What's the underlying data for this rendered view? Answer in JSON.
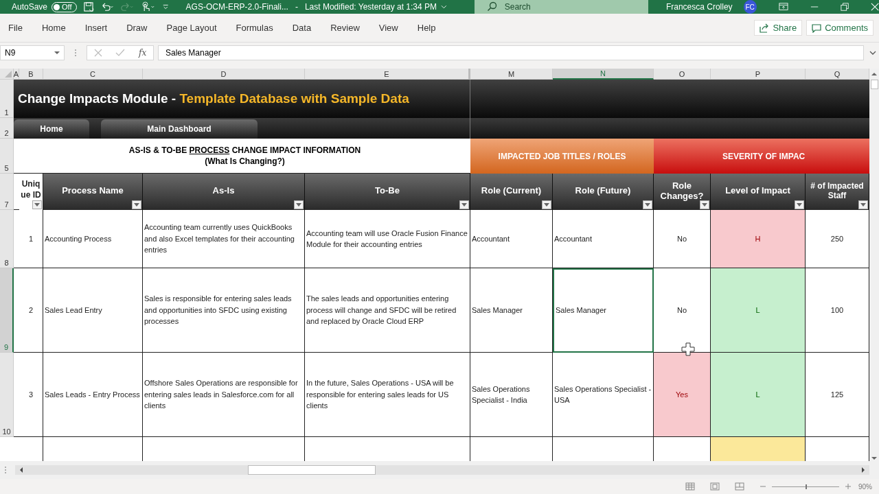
{
  "title_bar": {
    "autosave_label": "AutoSave",
    "autosave_toggle": {
      "label": "Off",
      "on": false
    },
    "document_title": "AGS-OCM-ERP-2.0-Finali...",
    "separator": "-",
    "modified": "Last Modified: Yesterday at 1:34 PM",
    "search_placeholder": "Search",
    "user_name": "Francesca Crolley",
    "user_initials": "FC"
  },
  "ribbon_tabs": [
    {
      "label": "File",
      "selected": false
    },
    {
      "label": "Home",
      "selected": false
    },
    {
      "label": "Insert",
      "selected": false
    },
    {
      "label": "Draw",
      "selected": false
    },
    {
      "label": "Page Layout",
      "selected": false
    },
    {
      "label": "Formulas",
      "selected": false
    },
    {
      "label": "Data",
      "selected": false
    },
    {
      "label": "Review",
      "selected": false
    },
    {
      "label": "View",
      "selected": false
    },
    {
      "label": "Help",
      "selected": false
    }
  ],
  "share": "Share",
  "comments": "Comments",
  "formula_bar": {
    "name_box": "N9",
    "function_label": "fx",
    "value": "Sales Manager"
  },
  "column_headers": [
    {
      "label": "A",
      "selected": false
    },
    {
      "label": "B",
      "selected": false
    },
    {
      "label": "C",
      "selected": false
    },
    {
      "label": "D",
      "selected": false
    },
    {
      "label": "E",
      "selected": false
    },
    {
      "label": "M",
      "selected": false
    },
    {
      "label": "N",
      "selected": true
    },
    {
      "label": "O",
      "selected": false
    },
    {
      "label": "P",
      "selected": false
    },
    {
      "label": "Q",
      "selected": false
    }
  ],
  "row_headers": [
    {
      "label": "1",
      "selected": false
    },
    {
      "label": "2",
      "selected": false
    },
    {
      "label": "5",
      "selected": false
    },
    {
      "label": "7",
      "selected": false
    },
    {
      "label": "8",
      "selected": false
    },
    {
      "label": "9",
      "selected": true
    },
    {
      "label": "10",
      "selected": false
    }
  ],
  "banner": {
    "title": "Change Impacts Module - ",
    "subtitle": "Template Database with Sample Data"
  },
  "nav_buttons": [
    "Home",
    "Main Dashboard"
  ],
  "process_section": {
    "before": "AS-IS & TO-BE ",
    "underlined": "PROCESS",
    "after": " CHANGE IMPACT INFORMATION",
    "subtitle": "(What Is Changing?)"
  },
  "group_headers": [
    "IMPACTED JOB TITLES / ROLES",
    "SEVERITY OF IMPAC"
  ],
  "columns": [
    "Unique ID",
    "Process Name",
    "As-Is",
    "To-Be",
    "Role (Current)",
    "Role (Future)",
    "Role Changes?",
    "Level of Impact",
    "# of Impacted Staff"
  ],
  "rows": [
    {
      "id": "1",
      "process": "Accounting Process",
      "as_is": "Accounting team currently uses QuickBooks and also Excel templates for their accounting entries",
      "to_be": "Accounting team will use Oracle Fusion Finance Module for their accounting entries",
      "role_current": "Accountant",
      "role_future": "Accountant",
      "role_future_selected": false,
      "role_changes": {
        "text": "No",
        "color": "#ffffff"
      },
      "level": {
        "text": "H",
        "color": "#f8c9cd"
      },
      "staff": "250"
    },
    {
      "id": "2",
      "process": "Sales Lead Entry",
      "as_is": "Sales is responsible for entering sales leads and opportunities into SFDC using existing processes",
      "to_be": "The sales leads and opportunities entering process will change and SFDC will be retired and replaced by Oracle Cloud ERP",
      "role_current": "Sales Manager",
      "role_future": "Sales Manager",
      "role_future_selected": true,
      "role_changes": {
        "text": "No",
        "color": "#ffffff"
      },
      "level": {
        "text": "L",
        "color": "#c6efce"
      },
      "staff": "100"
    },
    {
      "id": "3",
      "process": "Sales Leads - Entry Process",
      "as_is": "Offshore Sales Operations are responsible for entering sales leads in Salesforce.com for all clients",
      "to_be": "In the future, Sales Operations - USA will be responsible for entering sales leads for US clients",
      "role_current": "Sales Operations Specialist - India",
      "role_future": "Sales Operations Specialist - USA",
      "role_future_selected": false,
      "role_changes": {
        "text": "Yes",
        "color": "#f8c9cd"
      },
      "level": {
        "text": "L",
        "color": "#c6efce"
      },
      "staff": "125"
    }
  ],
  "partial_row": {
    "level": {
      "color": "#fbe89a"
    }
  },
  "status_bar": {
    "zoom_slider": {
      "level": 0.5
    },
    "zoom": "90%"
  }
}
